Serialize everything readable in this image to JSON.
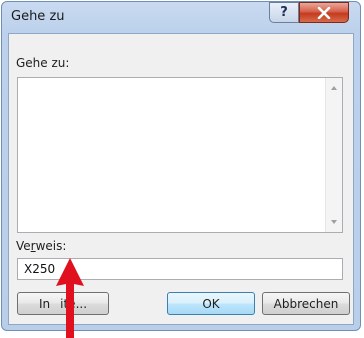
{
  "window": {
    "title": "Gehe zu",
    "help_symbol": "?",
    "close_symbol": "X"
  },
  "goto": {
    "list_label": "Gehe zu:",
    "list_items": [],
    "reference_label_prefix": "Ve",
    "reference_label_mnemonic": "r",
    "reference_label_suffix": "weis:",
    "reference_value": "X250"
  },
  "buttons": {
    "contents_prefix": "In",
    "contents_suffix": "ite...",
    "ok": "OK",
    "cancel": "Abbrechen"
  },
  "colors": {
    "annotation_arrow": "#e0101e",
    "title_bar": "#bcd1ec",
    "close_button": "#c43a1f"
  }
}
